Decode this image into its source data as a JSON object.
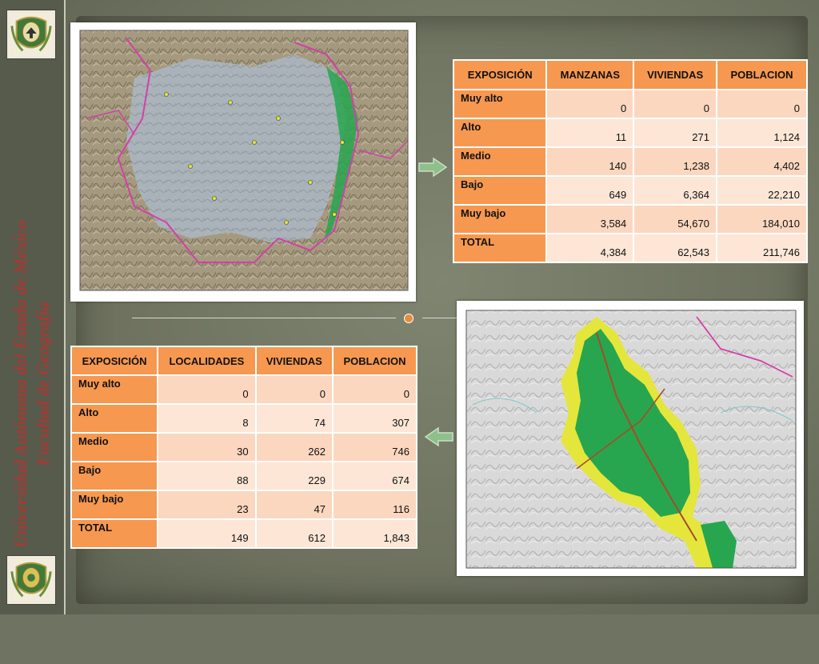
{
  "sidebar": {
    "university": "Universidad Autónoma del Estado de México",
    "faculty": "Facultad de Geografía"
  },
  "table_top": {
    "headers": [
      "EXPOSICIÓN",
      "MANZANAS",
      "VIVIENDAS",
      "POBLACION"
    ],
    "rows": [
      {
        "label": "Muy alto",
        "values": [
          "0",
          "0",
          "0"
        ]
      },
      {
        "label": "Alto",
        "values": [
          "11",
          "271",
          "1,124"
        ]
      },
      {
        "label": "Medio",
        "values": [
          "140",
          "1,238",
          "4,402"
        ]
      },
      {
        "label": "Bajo",
        "values": [
          "649",
          "6,364",
          "22,210"
        ]
      },
      {
        "label": "Muy bajo",
        "values": [
          "3,584",
          "54,670",
          "184,010"
        ]
      },
      {
        "label": "TOTAL",
        "values": [
          "4,384",
          "62,543",
          "211,746"
        ]
      }
    ]
  },
  "table_bottom": {
    "headers": [
      "EXPOSICIÓN",
      "LOCALIDADES",
      "VIVIENDAS",
      "POBLACION"
    ],
    "rows": [
      {
        "label": "Muy alto",
        "values": [
          "0",
          "0",
          "0"
        ]
      },
      {
        "label": "Alto",
        "values": [
          "8",
          "74",
          "307"
        ]
      },
      {
        "label": "Medio",
        "values": [
          "30",
          "262",
          "746"
        ]
      },
      {
        "label": "Bajo",
        "values": [
          "88",
          "229",
          "674"
        ]
      },
      {
        "label": "Muy bajo",
        "values": [
          "23",
          "47",
          "116"
        ]
      },
      {
        "label": "TOTAL",
        "values": [
          "149",
          "612",
          "1,843"
        ]
      }
    ]
  },
  "colors": {
    "header_orange": "#f6984f",
    "cell_peach": "#fbd7bf",
    "title_red": "#a33b35",
    "arrow_green": "#8fbf8a"
  },
  "icons": {
    "arrow_right": "arrow-right-icon",
    "arrow_left": "arrow-left-icon",
    "logo": "university-crest-logo"
  }
}
